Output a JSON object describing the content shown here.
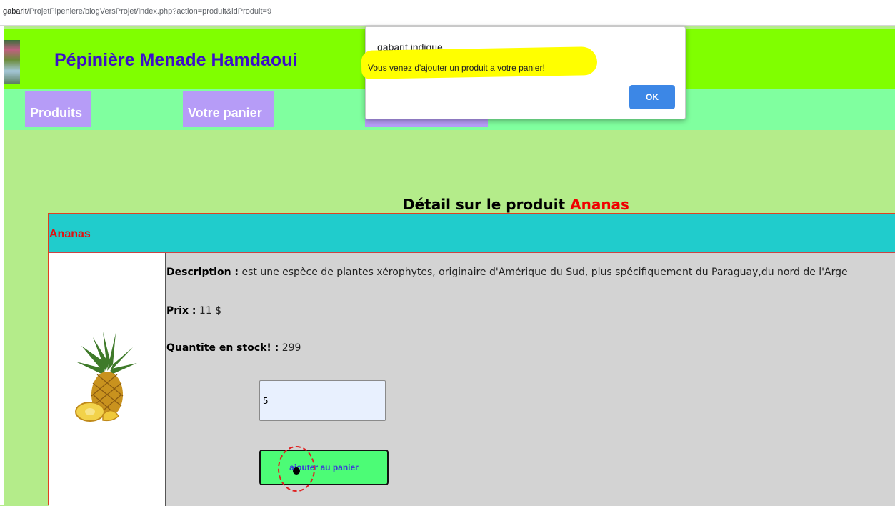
{
  "browser": {
    "url_host": "gabarit",
    "url_path": "/ProjetPipeniere/blogVersProjet/index.php?action=produit&idProduit=9"
  },
  "header": {
    "site_title": "Pépinière Menade Hamdaoui"
  },
  "nav": {
    "items": [
      {
        "label": "Produits"
      },
      {
        "label": "Votre panier"
      },
      {
        "label": ""
      }
    ],
    "colors": {
      "item_bg": "#b69cf7",
      "bar_bg": "#80ff9f",
      "header_bg": "#80ff00"
    }
  },
  "product": {
    "heading_prefix": "Détail sur le produit",
    "name": "Ananas",
    "description_label": "Description :",
    "description_text": "est une espèce de plantes xérophytes, originaire d'Amérique du Sud, plus spécifiquement du Paraguay,du nord de l'Arge",
    "price_label": "Prix :",
    "price_value": "11 $",
    "stock_label": "Quantite en stock! :",
    "stock_value": "299",
    "quantity_value": "5",
    "add_button_label": "ajouter au panier",
    "image_icon": "pineapple-image"
  },
  "dialog": {
    "title": "gabarit indique",
    "message": "Vous venez d'ajouter un produit a votre panier!",
    "ok_label": "OK",
    "colors": {
      "ok_bg": "#3c87e6",
      "highlight": "#ffff00"
    }
  }
}
